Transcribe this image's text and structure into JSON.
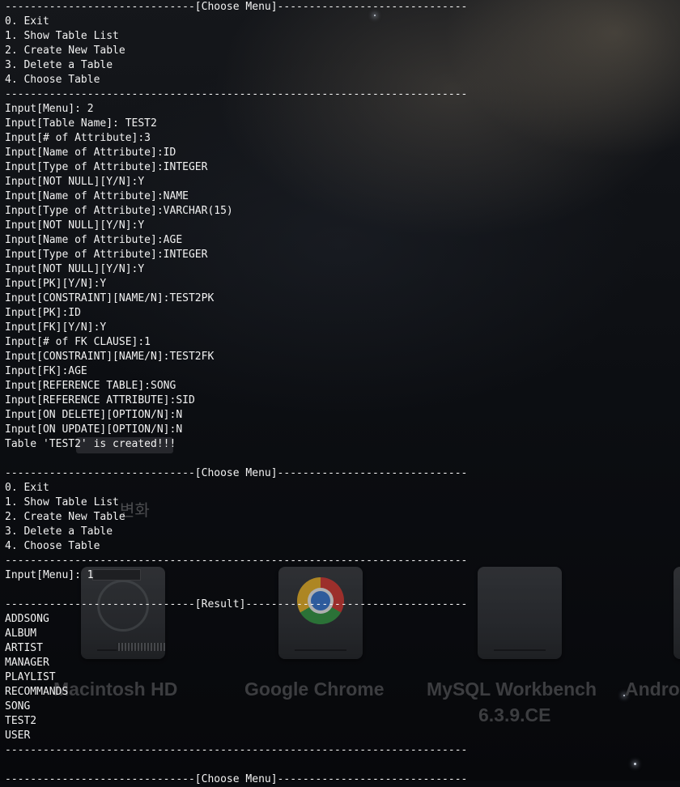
{
  "desktop": {
    "icons": [
      {
        "label": "Macintosh HD"
      },
      {
        "label": "Google Chrome"
      },
      {
        "label": "MySQL Workbench",
        "label2": "6.3.9.CE"
      },
      {
        "label": "Andro"
      }
    ],
    "ghost_text": "변화"
  },
  "terminal": {
    "lines": [
      "------------------------------[Choose Menu]------------------------------",
      "0. Exit",
      "1. Show Table List",
      "2. Create New Table",
      "3. Delete a Table",
      "4. Choose Table",
      "-------------------------------------------------------------------------",
      "Input[Menu]: 2",
      "Input[Table Name]: TEST2",
      "Input[# of Attribute]:3",
      "Input[Name of Attribute]:ID",
      "Input[Type of Attribute]:INTEGER",
      "Input[NOT NULL][Y/N]:Y",
      "Input[Name of Attribute]:NAME",
      "Input[Type of Attribute]:VARCHAR(15)",
      "Input[NOT NULL][Y/N]:Y",
      "Input[Name of Attribute]:AGE",
      "Input[Type of Attribute]:INTEGER",
      "Input[NOT NULL][Y/N]:Y",
      "Input[PK][Y/N]:Y",
      "Input[CONSTRAINT][NAME/N]:TEST2PK",
      "Input[PK]:ID",
      "Input[FK][Y/N]:Y",
      "Input[# of FK CLAUSE]:1",
      "Input[CONSTRAINT][NAME/N]:TEST2FK",
      "Input[FK]:AGE",
      "Input[REFERENCE TABLE]:SONG",
      "Input[REFERENCE ATTRIBUTE]:SID",
      "Input[ON DELETE][OPTION/N]:N",
      "Input[ON UPDATE][OPTION/N]:N",
      "Table 'TEST2' is created!!!",
      "",
      "------------------------------[Choose Menu]------------------------------",
      "0. Exit",
      "1. Show Table List",
      "2. Create New Table",
      "3. Delete a Table",
      "4. Choose Table",
      "-------------------------------------------------------------------------",
      "Input[Menu]: 1",
      "",
      "------------------------------[Result]-----------------------------------",
      "ADDSONG",
      "ALBUM",
      "ARTIST",
      "MANAGER",
      "PLAYLIST",
      "RECOMMANDS",
      "SONG",
      "TEST2",
      "USER",
      "-------------------------------------------------------------------------",
      "",
      "------------------------------[Choose Menu]------------------------------"
    ]
  }
}
